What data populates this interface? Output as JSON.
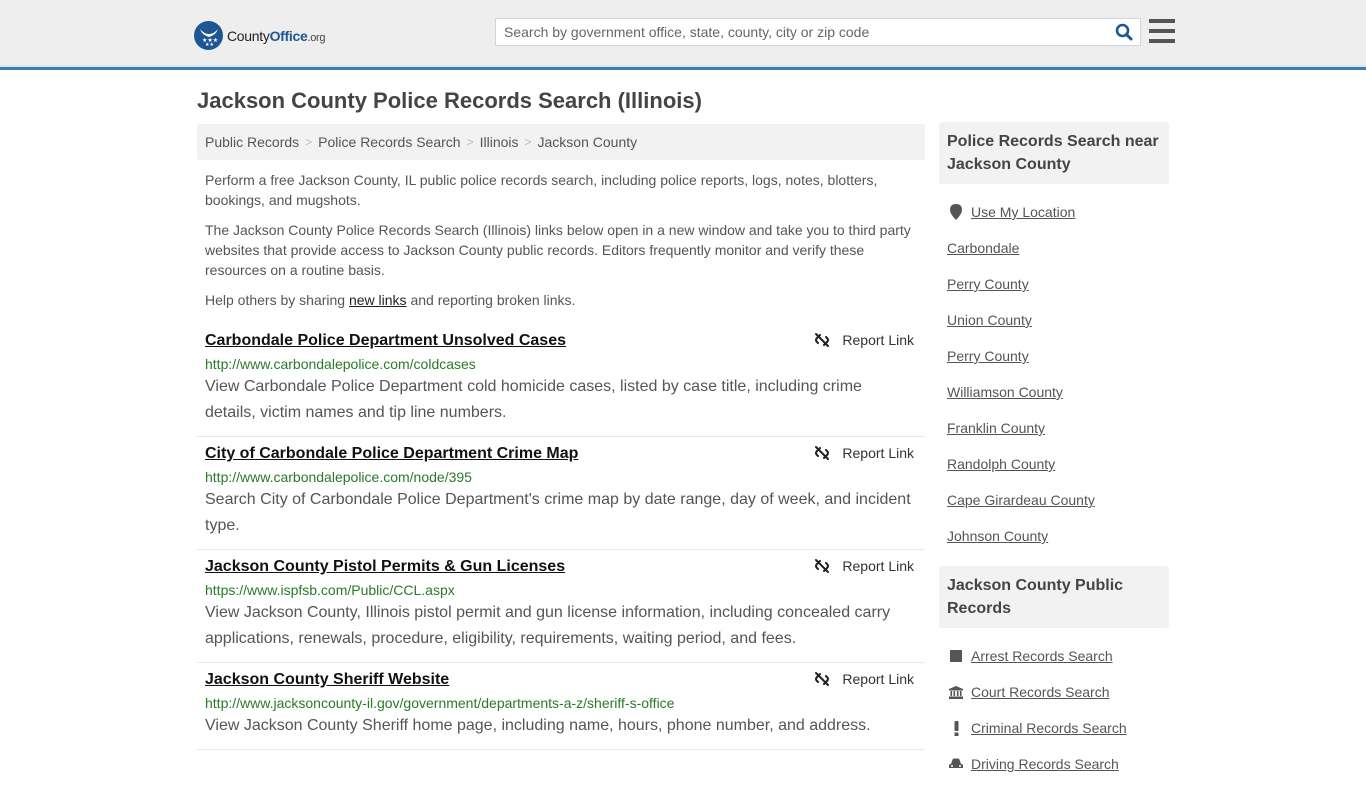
{
  "header": {
    "logo": {
      "name": "County",
      "name_bold": "Office",
      "tld": ".org"
    },
    "search": {
      "placeholder": "Search by government office, state, county, city or zip code",
      "value": ""
    },
    "colors": {
      "accent": "#3c7cb0",
      "brand": "#1e5593"
    }
  },
  "page": {
    "title": "Jackson County Police Records Search (Illinois)",
    "breadcrumb": [
      "Public Records",
      "Police Records Search",
      "Illinois",
      "Jackson County"
    ],
    "intro": {
      "p1": "Perform a free Jackson County, IL public police records search, including police reports, logs, notes, blotters, bookings, and mugshots.",
      "p2": "The Jackson County Police Records Search (Illinois) links below open in a new window and take you to third party websites that provide access to Jackson County public records. Editors frequently monitor and verify these resources on a routine basis.",
      "p3_before": "Help others by sharing ",
      "p3_link": "new links",
      "p3_after": " and reporting broken links."
    }
  },
  "results": [
    {
      "title": "Carbondale Police Department Unsolved Cases",
      "url": "http://www.carbondalepolice.com/coldcases",
      "description": "View Carbondale Police Department cold homicide cases, listed by case title, including crime details, victim names and tip line numbers.",
      "report_label": "Report Link"
    },
    {
      "title": "City of Carbondale Police Department Crime Map",
      "url": "http://www.carbondalepolice.com/node/395",
      "description": "Search City of Carbondale Police Department's crime map by date range, day of week, and incident type.",
      "report_label": "Report Link"
    },
    {
      "title": "Jackson County Pistol Permits & Gun Licenses",
      "url": "https://www.ispfsb.com/Public/CCL.aspx",
      "description": "View Jackson County, Illinois pistol permit and gun license information, including concealed carry applications, renewals, procedure, eligibility, requirements, waiting period, and fees.",
      "report_label": "Report Link"
    },
    {
      "title": "Jackson County Sheriff Website",
      "url": "http://www.jacksoncounty-il.gov/government/departments-a-z/sheriff-s-office",
      "description": "View Jackson County Sheriff home page, including name, hours, phone number, and address.",
      "report_label": "Report Link"
    }
  ],
  "sidebar": {
    "nearby": {
      "heading": "Police Records Search near Jackson County",
      "use_location": "Use My Location",
      "items": [
        "Carbondale",
        "Perry County",
        "Union County",
        "Perry County",
        "Williamson County",
        "Franklin County",
        "Randolph County",
        "Cape Girardeau County",
        "Johnson County"
      ]
    },
    "public_records": {
      "heading": "Jackson County Public Records",
      "items": [
        {
          "label": "Arrest Records Search",
          "icon": "square-icon"
        },
        {
          "label": "Court Records Search",
          "icon": "bank-icon"
        },
        {
          "label": "Criminal Records Search",
          "icon": "exclamation-icon"
        },
        {
          "label": "Driving Records Search",
          "icon": "car-icon"
        }
      ]
    }
  }
}
